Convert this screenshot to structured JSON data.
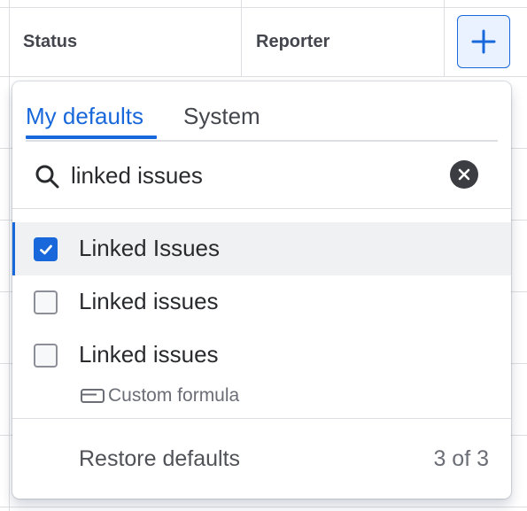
{
  "table": {
    "columns": [
      {
        "label": "Status"
      },
      {
        "label": "Reporter"
      }
    ],
    "add_column_icon": "plus-icon"
  },
  "popup": {
    "tabs": [
      {
        "label": "My defaults",
        "active": true
      },
      {
        "label": "System",
        "active": false
      }
    ],
    "search": {
      "value": "linked issues",
      "icon": "search-icon",
      "clear_icon": "clear-icon"
    },
    "options": [
      {
        "label": "Linked Issues",
        "checked": true,
        "highlighted": true
      },
      {
        "label": "Linked issues",
        "checked": false
      },
      {
        "label": "Linked issues",
        "checked": false,
        "sublabel": "Custom formula",
        "sublabel_icon": "formula-icon"
      }
    ],
    "footer": {
      "restore_label": "Restore defaults",
      "count_label": "3 of 3"
    }
  },
  "colors": {
    "accent": "#1868db",
    "text": "#292a2e",
    "subtle_text": "#6b6e76",
    "border": "#dddee1",
    "selected_bg": "#f0f1f2"
  }
}
